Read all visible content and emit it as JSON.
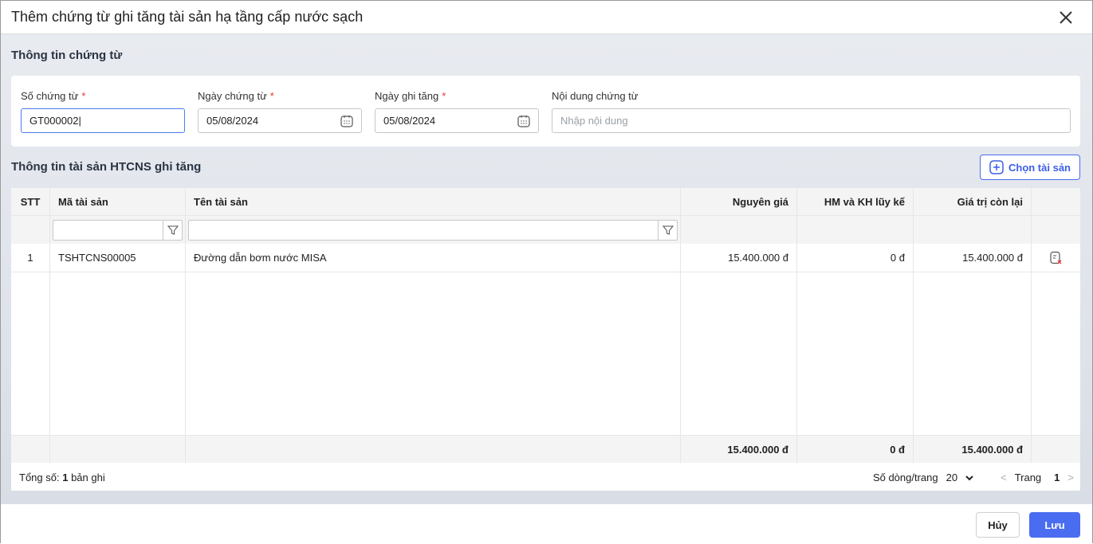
{
  "dialog": {
    "title": "Thêm chứng từ ghi tăng tài sản hạ tầng cấp nước sạch"
  },
  "voucher": {
    "section_title": "Thông tin chứng từ",
    "so_label": "Số chứng từ",
    "so_value": "GT000002",
    "ngay_ct_label": "Ngày chứng từ",
    "ngay_ct_value": "05/08/2024",
    "ngay_gt_label": "Ngày ghi tăng",
    "ngay_gt_value": "05/08/2024",
    "noidung_label": "Nội dung chứng từ",
    "noidung_placeholder": "Nhập nội dung",
    "required_mark": "*"
  },
  "assets": {
    "section_title": "Thông tin tài sản HTCNS ghi tăng",
    "pick_button": "Chọn tài sản",
    "columns": [
      "STT",
      "Mã tài sản",
      "Tên tài sản",
      "Nguyên giá",
      "HM và KH lũy kế",
      "Giá trị còn lại"
    ],
    "rows": [
      {
        "stt": "1",
        "ma": "TSHTCNS00005",
        "ten": "Đường dẫn bơm nước MISA",
        "nguyen_gia": "15.400.000 đ",
        "hm": "0 đ",
        "con_lai": "15.400.000 đ"
      }
    ],
    "totals": {
      "nguyen_gia": "15.400.000 đ",
      "hm": "0 đ",
      "con_lai": "15.400.000 đ"
    },
    "pager": {
      "total_prefix": "Tổng số:",
      "total_count": "1",
      "total_suffix": "bản ghi",
      "page_size_label": "Số dòng/trang",
      "page_size": "20",
      "prev": "<",
      "page_label": "Trang",
      "page": "1",
      "next": ">"
    }
  },
  "footer": {
    "cancel": "Hủy",
    "save": "Lưu"
  },
  "colors": {
    "accent": "#4a6cf0",
    "required": "#e53935"
  }
}
